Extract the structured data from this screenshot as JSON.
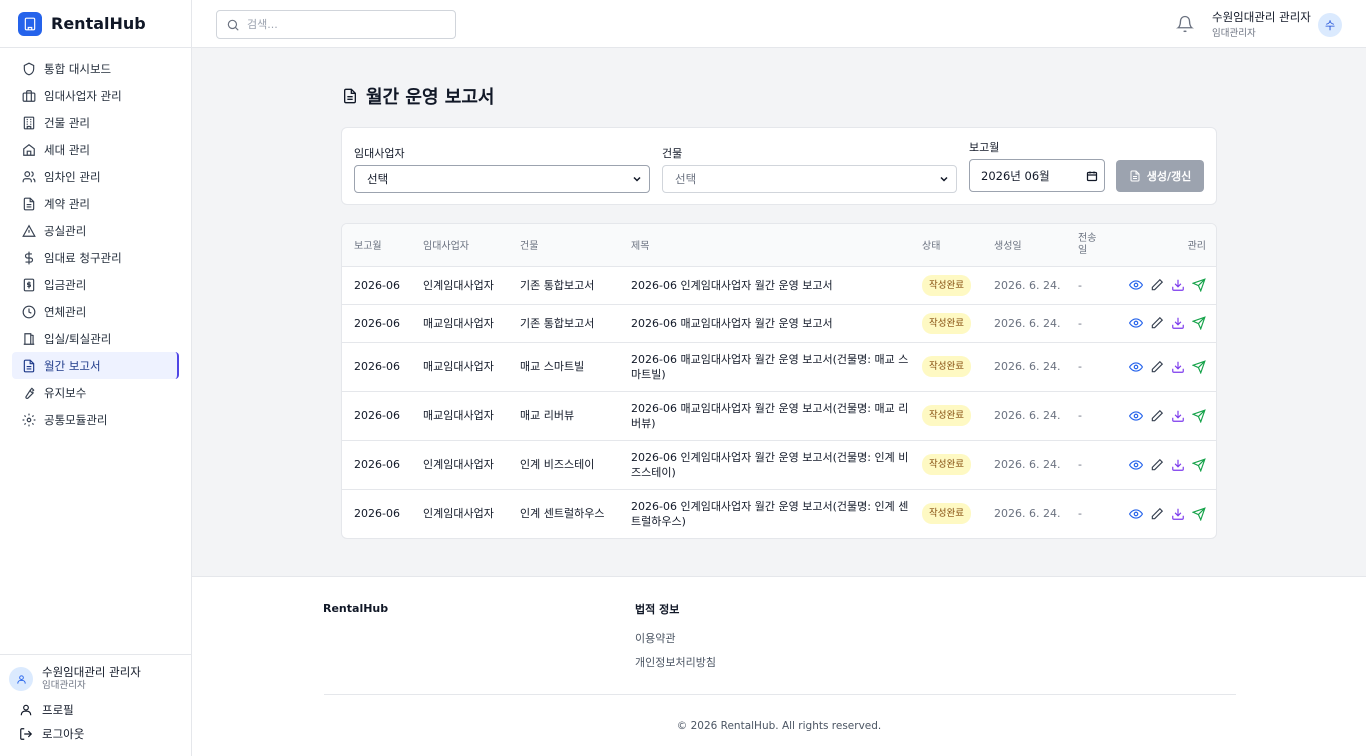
{
  "app": {
    "name": "RentalHub"
  },
  "search": {
    "placeholder": "검색..."
  },
  "user": {
    "name": "수원임대관리 관리자",
    "role": "임대관리자",
    "initial": "수"
  },
  "sidebar": {
    "items": [
      {
        "label": "통합 대시보드",
        "icon": "shield-icon"
      },
      {
        "label": "임대사업자 관리",
        "icon": "briefcase-icon"
      },
      {
        "label": "건물 관리",
        "icon": "building-icon"
      },
      {
        "label": "세대 관리",
        "icon": "home-icon"
      },
      {
        "label": "임차인 관리",
        "icon": "users-icon"
      },
      {
        "label": "계약 관리",
        "icon": "document-icon"
      },
      {
        "label": "공실관리",
        "icon": "warning-icon"
      },
      {
        "label": "임대료 청구관리",
        "icon": "dollar-icon"
      },
      {
        "label": "입금관리",
        "icon": "receipt-icon"
      },
      {
        "label": "연체관리",
        "icon": "clock-icon"
      },
      {
        "label": "입실/퇴실관리",
        "icon": "door-icon"
      },
      {
        "label": "월간 보고서",
        "icon": "report-icon",
        "active": true
      },
      {
        "label": "유지보수",
        "icon": "wrench-icon"
      },
      {
        "label": "공통모듈관리",
        "icon": "gear-icon"
      }
    ],
    "profile_label": "프로필",
    "logout_label": "로그아웃"
  },
  "page": {
    "title": "월간 운영 보고서"
  },
  "filters": {
    "lessor_label": "임대사업자",
    "lessor_value": "선택",
    "building_label": "건물",
    "building_value": "선택",
    "month_label": "보고월",
    "month_value": "2026년 06월",
    "generate_label": "생성/갱신"
  },
  "table": {
    "headers": [
      "보고월",
      "임대사업자",
      "건물",
      "제목",
      "상태",
      "생성일",
      "전송일",
      "관리"
    ],
    "rows": [
      {
        "month": "2026-06",
        "lessor": "인계임대사업자",
        "building": "기존 통합보고서",
        "title": "2026-06 인계임대사업자 월간 운영 보고서",
        "status": "작성완료",
        "created": "2026. 6. 24.",
        "sent": "-"
      },
      {
        "month": "2026-06",
        "lessor": "매교임대사업자",
        "building": "기존 통합보고서",
        "title": "2026-06 매교임대사업자 월간 운영 보고서",
        "status": "작성완료",
        "created": "2026. 6. 24.",
        "sent": "-"
      },
      {
        "month": "2026-06",
        "lessor": "매교임대사업자",
        "building": "매교 스마트빌",
        "title": "2026-06 매교임대사업자 월간 운영 보고서(건물명: 매교 스마트빌)",
        "status": "작성완료",
        "created": "2026. 6. 24.",
        "sent": "-"
      },
      {
        "month": "2026-06",
        "lessor": "매교임대사업자",
        "building": "매교 리버뷰",
        "title": "2026-06 매교임대사업자 월간 운영 보고서(건물명: 매교 리버뷰)",
        "status": "작성완료",
        "created": "2026. 6. 24.",
        "sent": "-"
      },
      {
        "month": "2026-06",
        "lessor": "인계임대사업자",
        "building": "인계 비즈스테이",
        "title": "2026-06 인계임대사업자 월간 운영 보고서(건물명: 인계 비즈스테이)",
        "status": "작성완료",
        "created": "2026. 6. 24.",
        "sent": "-"
      },
      {
        "month": "2026-06",
        "lessor": "인계임대사업자",
        "building": "인계 센트럴하우스",
        "title": "2026-06 인계임대사업자 월간 운영 보고서(건물명: 인계 센트럴하우스)",
        "status": "작성완료",
        "created": "2026. 6. 24.",
        "sent": "-"
      }
    ]
  },
  "footer": {
    "brand": "RentalHub",
    "legal_heading": "법적 정보",
    "terms": "이용약관",
    "privacy": "개인정보처리방침",
    "copyright": "© 2026 RentalHub. All rights reserved."
  },
  "colors": {
    "accent": "#2563eb",
    "badge_bg": "#fef9c3",
    "badge_text": "#854d0e",
    "send": "#16a34a",
    "download": "#7c3aed"
  }
}
